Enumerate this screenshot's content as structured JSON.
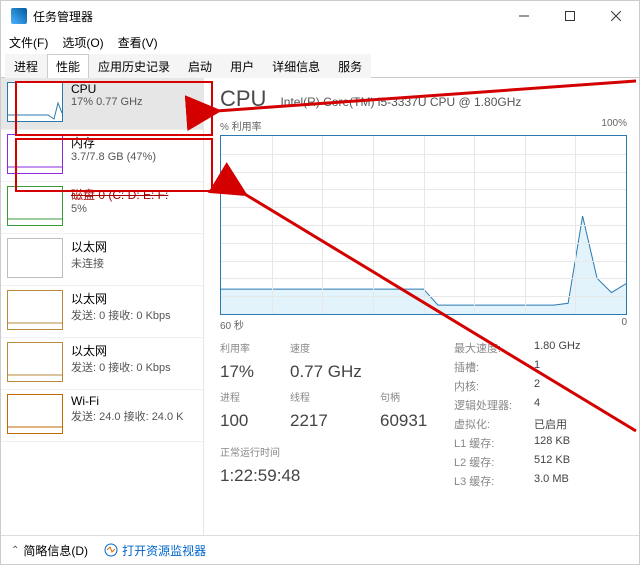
{
  "title": "任务管理器",
  "menus": {
    "file": "文件(F)",
    "options": "选项(O)",
    "view": "查看(V)"
  },
  "tabs": {
    "proc": "进程",
    "perf": "性能",
    "hist": "应用历史记录",
    "startup": "启动",
    "users": "用户",
    "details": "详细信息",
    "services": "服务"
  },
  "sidebar": [
    {
      "name": "CPU",
      "sub": "17% 0.77 GHz",
      "color": "#2a7ab0"
    },
    {
      "name": "内存",
      "sub": "3.7/7.8 GB (47%)",
      "color": "#8a2be2"
    },
    {
      "name": "磁盘 0 (C: D: E: F:",
      "sub": "5%",
      "color": "#3a9a3a",
      "strike": true
    },
    {
      "name": "以太网",
      "sub": "未连接",
      "color": "#bdbdbd",
      "unused": true
    },
    {
      "name": "以太网",
      "sub": "发送: 0 接收: 0 Kbps",
      "color": "#b88a3a"
    },
    {
      "name": "以太网",
      "sub": "发送: 0 接收: 0 Kbps",
      "color": "#b88a3a"
    },
    {
      "name": "Wi-Fi",
      "sub": "发送: 24.0 接收: 24.0 K",
      "color": "#c06a00"
    }
  ],
  "main": {
    "title": "CPU",
    "subtitle": "Intel(R) Core(TM) i5-3337U CPU @ 1.80GHz",
    "axis_tl": "% 利用率",
    "axis_tr": "100%",
    "axis_bl": "60 秒",
    "axis_br": "0",
    "labels": {
      "util": "利用率",
      "speed": "速度",
      "uptime": "正常运行时间",
      "proc": "进程",
      "threads": "线程",
      "handles": "句柄"
    },
    "vals": {
      "util": "17%",
      "speed": "0.77 GHz",
      "proc": "100",
      "threads": "2217",
      "handles": "60931",
      "uptime": "1:22:59:48"
    },
    "right": [
      {
        "k": "最大速度:",
        "v": "1.80 GHz"
      },
      {
        "k": "插槽:",
        "v": "1"
      },
      {
        "k": "内核:",
        "v": "2"
      },
      {
        "k": "逻辑处理器:",
        "v": "4"
      },
      {
        "k": "虚拟化:",
        "v": "已启用"
      },
      {
        "k": "L1 缓存:",
        "v": "128 KB"
      },
      {
        "k": "L2 缓存:",
        "v": "512 KB"
      },
      {
        "k": "L3 缓存:",
        "v": "3.0 MB"
      }
    ]
  },
  "footer": {
    "brief": "简略信息(D)",
    "link": "打开资源监视器"
  },
  "chart_data": {
    "type": "line",
    "title": "CPU % 利用率",
    "ylabel": "% 利用率",
    "ylim": [
      0,
      100
    ],
    "xlabel": "秒",
    "xlim": [
      60,
      0
    ],
    "series": [
      {
        "name": "CPU",
        "values": [
          14,
          14,
          14,
          14,
          14,
          14,
          14,
          14,
          14,
          14,
          14,
          14,
          14,
          14,
          14,
          5,
          5,
          5,
          5,
          5,
          5,
          5,
          5,
          5,
          6,
          55,
          20,
          12,
          17
        ]
      }
    ]
  }
}
